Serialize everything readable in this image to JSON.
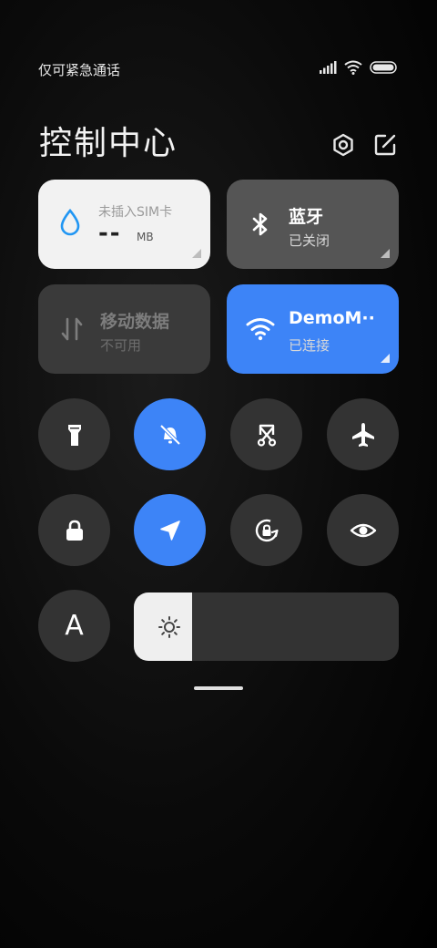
{
  "status_bar": {
    "carrier_text": "仅可紧急通话",
    "icons": [
      "signal-icon",
      "wifi-icon",
      "battery-icon"
    ]
  },
  "header": {
    "title": "控制中心",
    "settings_icon": "settings-icon",
    "edit_icon": "edit-icon"
  },
  "cards": {
    "data": {
      "label": "未插入SIM卡",
      "value": "--",
      "unit": "MB",
      "icon": "water-drop-icon"
    },
    "bluetooth": {
      "title": "蓝牙",
      "status": "已关闭",
      "icon": "bluetooth-icon"
    },
    "mobile_data": {
      "title": "移动数据",
      "status": "不可用",
      "icon": "mobile-data-icon"
    },
    "wifi": {
      "title": "DemoM··",
      "status": "已连接",
      "icon": "wifi-icon"
    }
  },
  "toggles": [
    {
      "name": "flashlight",
      "icon": "flashlight-icon",
      "active": false
    },
    {
      "name": "mute",
      "icon": "bell-off-icon",
      "active": true
    },
    {
      "name": "screenshot",
      "icon": "screenshot-icon",
      "active": false
    },
    {
      "name": "airplane",
      "icon": "airplane-icon",
      "active": false
    },
    {
      "name": "lock",
      "icon": "lock-icon",
      "active": false
    },
    {
      "name": "location",
      "icon": "location-icon",
      "active": true
    },
    {
      "name": "rotation-lock",
      "icon": "rotation-lock-icon",
      "active": false
    },
    {
      "name": "reading-mode",
      "icon": "eye-icon",
      "active": false
    }
  ],
  "font_button": {
    "label": "A",
    "icon": "font-size-icon"
  },
  "brightness": {
    "level": 0.22,
    "icon": "brightness-sun-icon"
  },
  "colors": {
    "accent": "#3d84f7",
    "tile": "#333333",
    "card_light": "#f2f2f2"
  }
}
